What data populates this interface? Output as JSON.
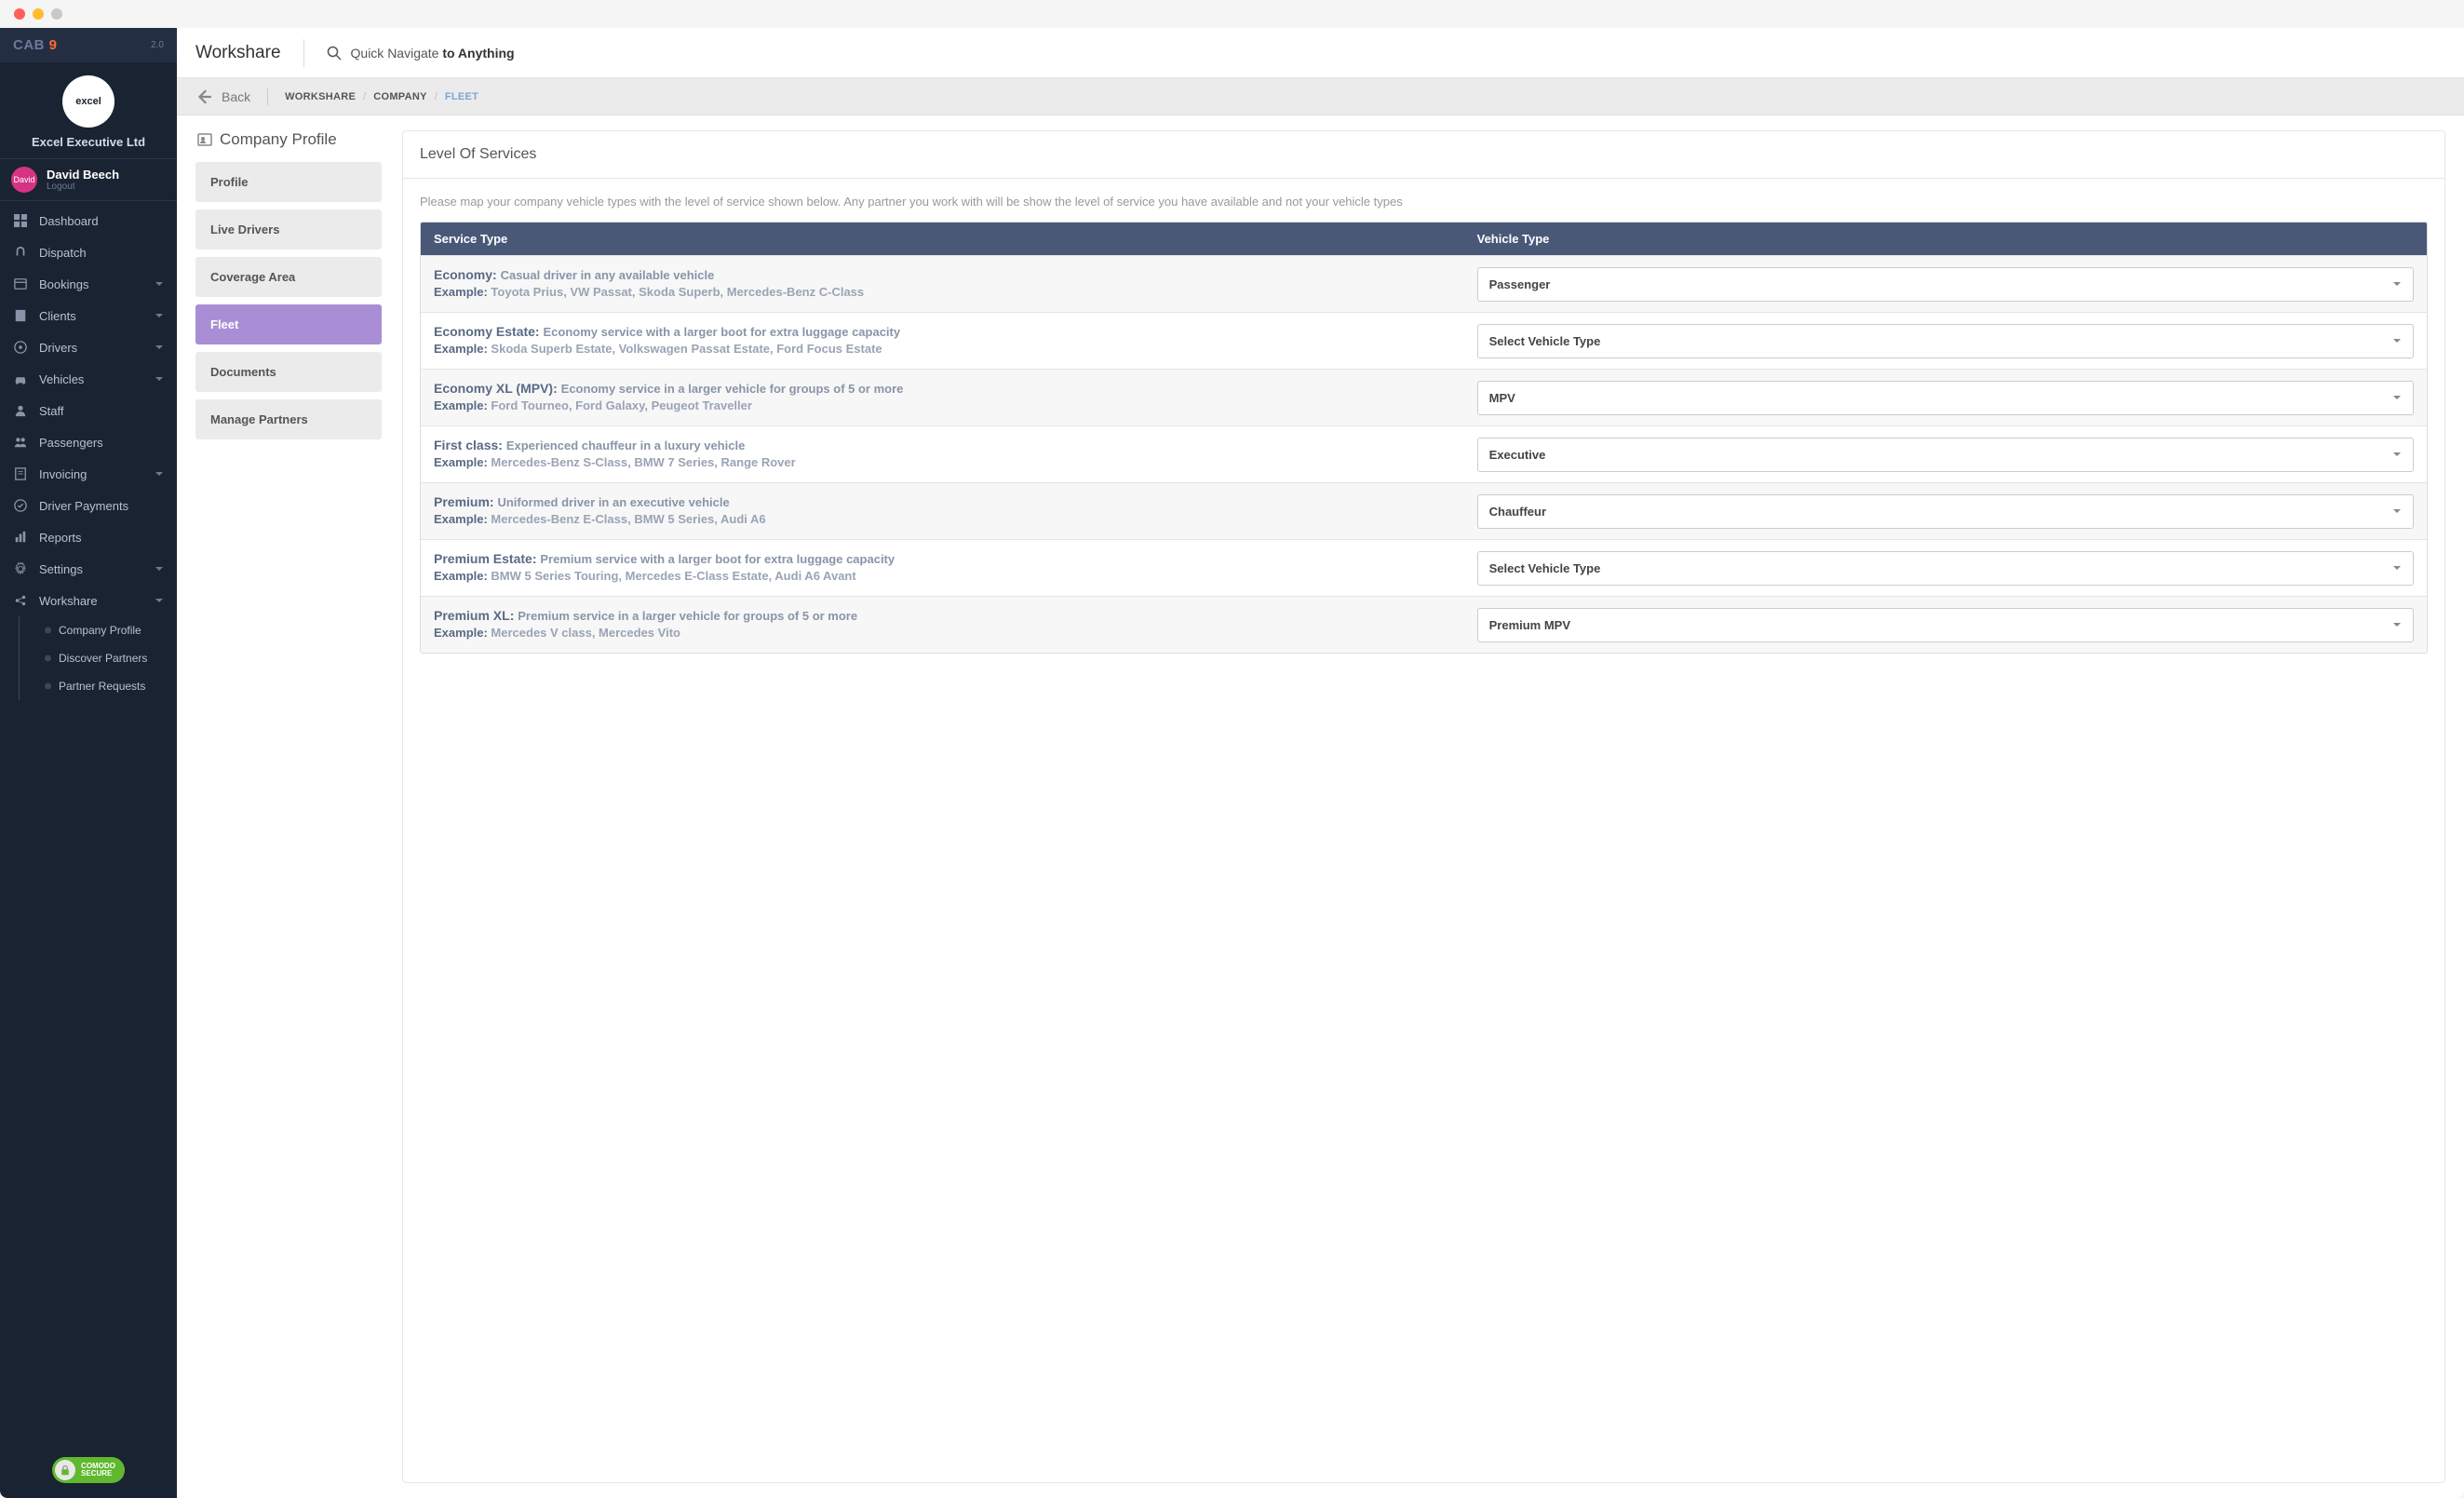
{
  "brand": {
    "text": "CAB ",
    "highlight": "9",
    "version": "2.0"
  },
  "company": {
    "name": "Excel Executive Ltd",
    "logo_text": "excel"
  },
  "user": {
    "name": "David Beech",
    "avatar_text": "David",
    "logout": "Logout"
  },
  "nav": {
    "items": [
      "Dashboard",
      "Dispatch",
      "Bookings",
      "Clients",
      "Drivers",
      "Vehicles",
      "Staff",
      "Passengers",
      "Invoicing",
      "Driver Payments",
      "Reports",
      "Settings",
      "Workshare"
    ],
    "subitems": [
      "Company Profile",
      "Discover Partners",
      "Partner Requests"
    ]
  },
  "secure_badge": {
    "line1": "COMODO",
    "line2": "SECURE"
  },
  "topbar": {
    "title": "Workshare",
    "search_prefix": "Quick Navigate ",
    "search_bold": "to Anything"
  },
  "breadcrumb": {
    "back": "Back",
    "crumbs": [
      "WORKSHARE",
      "COMPANY",
      "FLEET"
    ]
  },
  "section_title": "Company Profile",
  "tabs": [
    "Profile",
    "Live Drivers",
    "Coverage Area",
    "Fleet",
    "Documents",
    "Manage Partners"
  ],
  "active_tab": "Fleet",
  "panel": {
    "title": "Level Of Services",
    "description": "Please map your company vehicle types with the level of service shown below. Any partner you work with will be show the level of service you have available and not your vehicle types",
    "columns": {
      "service": "Service Type",
      "vehicle": "Vehicle Type"
    },
    "placeholder": "Select Vehicle Type",
    "rows": [
      {
        "name": "Economy:",
        "desc": "Casual driver in any available vehicle",
        "example": "Toyota Prius, VW Passat, Skoda Superb, Mercedes-Benz C-Class",
        "value": "Passenger"
      },
      {
        "name": "Economy Estate:",
        "desc": "Economy service with a larger boot for extra luggage capacity",
        "example": "Skoda Superb Estate, Volkswagen Passat Estate, Ford Focus Estate",
        "value": ""
      },
      {
        "name": "Economy XL (MPV):",
        "desc": "Economy service in a larger vehicle for groups of 5 or more",
        "example": "Ford Tourneo, Ford Galaxy, Peugeot Traveller",
        "value": "MPV"
      },
      {
        "name": "First class:",
        "desc": "Experienced chauffeur in a luxury vehicle",
        "example": "Mercedes-Benz S-Class, BMW 7 Series, Range Rover",
        "value": "Executive"
      },
      {
        "name": "Premium:",
        "desc": "Uniformed driver in an executive vehicle",
        "example": "Mercedes-Benz E-Class, BMW 5 Series, Audi A6",
        "value": "Chauffeur"
      },
      {
        "name": "Premium Estate:",
        "desc": "Premium service with a larger boot for extra luggage capacity",
        "example": "BMW 5 Series Touring, Mercedes E-Class Estate, Audi A6 Avant",
        "value": ""
      },
      {
        "name": "Premium XL:",
        "desc": "Premium service in a larger vehicle for groups of 5 or more",
        "example": "Mercedes V class, Mercedes Vito",
        "value": "Premium MPV"
      }
    ],
    "example_label": "Example: "
  }
}
